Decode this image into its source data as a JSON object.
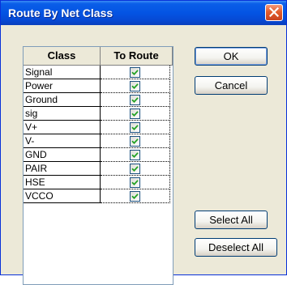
{
  "window": {
    "title": "Route By Net Class"
  },
  "table": {
    "columns": [
      "Class",
      "To Route"
    ],
    "rows": [
      {
        "class": "Signal",
        "to_route": true
      },
      {
        "class": "Power",
        "to_route": true
      },
      {
        "class": "Ground",
        "to_route": true
      },
      {
        "class": "sig",
        "to_route": true
      },
      {
        "class": "V+",
        "to_route": true
      },
      {
        "class": "V-",
        "to_route": true
      },
      {
        "class": "GND",
        "to_route": true
      },
      {
        "class": "PAIR",
        "to_route": true
      },
      {
        "class": "HSE",
        "to_route": true
      },
      {
        "class": "VCCO",
        "to_route": true
      }
    ]
  },
  "buttons": {
    "ok": "OK",
    "cancel": "Cancel",
    "select_all": "Select All",
    "deselect_all": "Deselect All"
  },
  "colors": {
    "title_bar": "#0454e3",
    "dialog_bg": "#ece9d8",
    "check_mark": "#21a121"
  },
  "icons": {
    "close": "close-icon",
    "check": "checkmark-icon"
  }
}
